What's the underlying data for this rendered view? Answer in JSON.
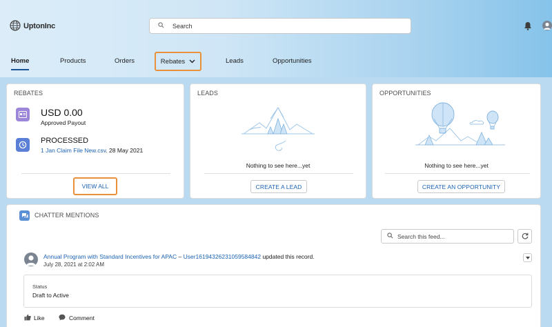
{
  "header": {
    "brand": "UptonInc",
    "search_placeholder": "Search",
    "icons": [
      "globe-icon",
      "search-icon",
      "bell-icon",
      "user-avatar-icon"
    ]
  },
  "nav": {
    "items": [
      "Home",
      "Products",
      "Orders",
      "Rebates",
      "Leads",
      "Opportunities"
    ],
    "active": "Home"
  },
  "rebates_card": {
    "title": "REBATES",
    "amount": "USD 0.00",
    "amount_label": "Approved Payout",
    "status": "PROCESSED",
    "file_link": "1 Jan Claim File New.csv",
    "date": ". 28 May 2021",
    "button": "VIEW ALL"
  },
  "leads_card": {
    "title": "LEADS",
    "empty_text": "Nothing to see here...yet",
    "button": "CREATE A LEAD"
  },
  "opportunities_card": {
    "title": "OPPORTUNITIES",
    "empty_text": "Nothing to see here...yet",
    "button": "CREATE AN OPPORTUNITY"
  },
  "chatter": {
    "title": "CHATTER MENTIONS",
    "search_placeholder": "Search this feed...",
    "post": {
      "record_link": "Annual Program with Standard Incentives for APAC",
      "separator": "–",
      "user_link": "User16194326231059584842",
      "action": "updated this record.",
      "timestamp": "July 28, 2021 at 2:02 AM",
      "field_label": "Status",
      "field_value": "Draft to Active"
    },
    "like": "Like",
    "comment": "Comment"
  },
  "colors": {
    "accent": "#1a62b3",
    "highlight": "#e8913a",
    "active_tab": "#1b5297",
    "icon_purple": "#9b86d9",
    "icon_blue": "#5a7fd6"
  }
}
